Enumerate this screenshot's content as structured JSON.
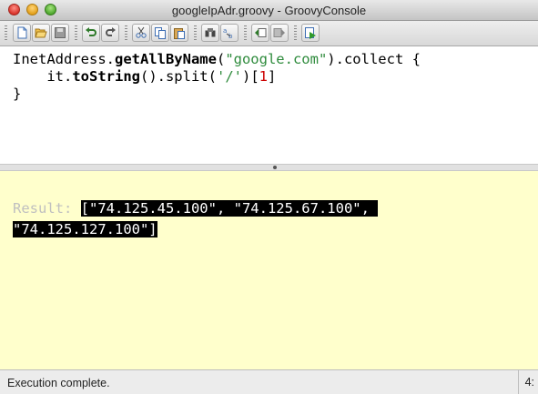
{
  "window": {
    "title": "googleIpAdr.groovy - GroovyConsole"
  },
  "toolbar": {
    "buttons": [
      {
        "name": "new-file-icon"
      },
      {
        "name": "open-file-icon"
      },
      {
        "name": "save-file-icon"
      },
      {
        "name": "undo-icon"
      },
      {
        "name": "redo-icon"
      },
      {
        "name": "cut-icon"
      },
      {
        "name": "copy-icon"
      },
      {
        "name": "paste-icon"
      },
      {
        "name": "find-icon"
      },
      {
        "name": "replace-icon"
      },
      {
        "name": "history-previous-icon"
      },
      {
        "name": "history-next-icon"
      },
      {
        "name": "run-script-icon"
      }
    ]
  },
  "editor": {
    "line1": {
      "obj": "InetAddress.",
      "method": "getAllByName",
      "open": "(",
      "str": "\"google.com\"",
      "rest": ").collect {"
    },
    "line2": {
      "indent": "    it.",
      "method": "toString",
      "mid": "().split(",
      "str": "'/'",
      "open": ")[",
      "num": "1",
      "close": "]"
    },
    "line3": "}"
  },
  "output": {
    "label": "Result: ",
    "line1": "[\"74.125.45.100\", \"74.125.67.100\", ",
    "line2": "\"74.125.127.100\"]"
  },
  "status": {
    "message": "Execution complete.",
    "position": "4:"
  },
  "colors": {
    "output_background": "#ffffcc",
    "string_literal": "#2e8b3c",
    "number_literal": "#cc0000",
    "selection": "#000000"
  }
}
